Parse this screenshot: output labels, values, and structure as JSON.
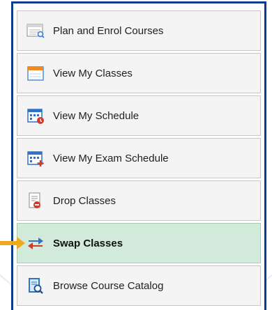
{
  "menu": {
    "items": [
      {
        "label": "Plan and Enrol Courses",
        "icon": "plan-courses-icon"
      },
      {
        "label": "View My Classes",
        "icon": "calendar-classes-icon"
      },
      {
        "label": "View My Schedule",
        "icon": "schedule-icon"
      },
      {
        "label": "View My Exam Schedule",
        "icon": "exam-schedule-icon"
      },
      {
        "label": "Drop Classes",
        "icon": "drop-classes-icon"
      },
      {
        "label": "Swap Classes",
        "icon": "swap-classes-icon",
        "selected": true
      },
      {
        "label": "Browse Course Catalog",
        "icon": "course-catalog-icon"
      }
    ]
  },
  "colors": {
    "panel_border": "#0c3c8c",
    "selected_row": "#d2ead9",
    "pointer_arrow": "#f0a81e"
  }
}
